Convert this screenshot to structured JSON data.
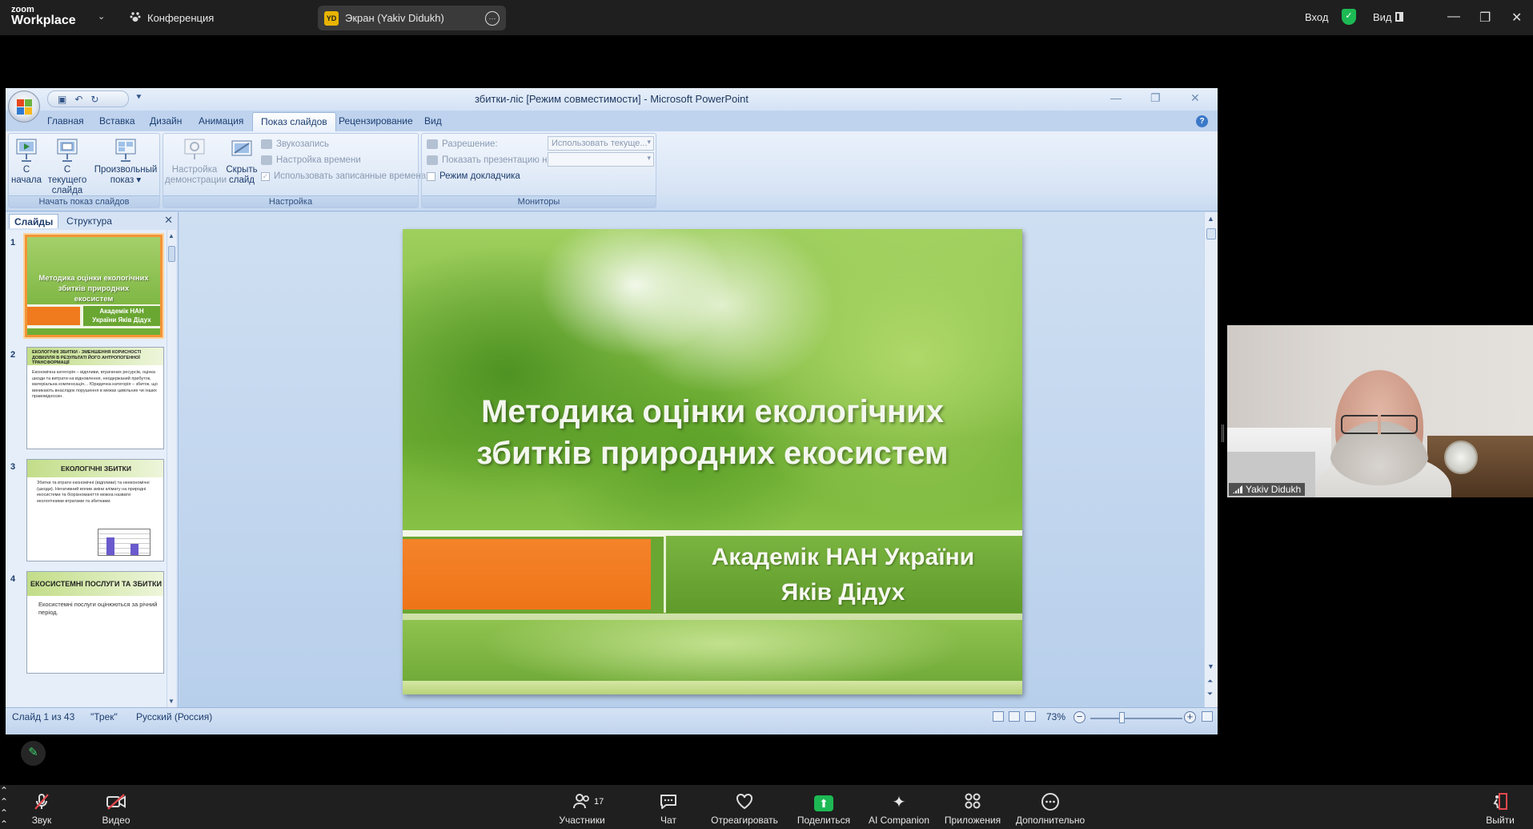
{
  "zoom": {
    "logo_line1": "zoom",
    "logo_line2": "Workplace",
    "conference_label": "Конференция",
    "screen_initials": "YD",
    "screen_label": "Экран (Yakiv Didukh)",
    "signin_label": "Вход",
    "view_label": "Вид",
    "toolbar": {
      "audio_label": "Звук",
      "video_label": "Видео",
      "participants_label": "Участники",
      "participants_count": "17",
      "chat_label": "Чат",
      "react_label": "Отреагировать",
      "share_label": "Поделиться",
      "ai_label": "AI Companion",
      "apps_label": "Приложения",
      "more_label": "Дополнительно",
      "leave_label": "Выйти"
    },
    "participant_name": "Yakiv Didukh"
  },
  "ppt": {
    "title": "збитки-ліс [Режим совместимости] - Microsoft PowerPoint",
    "tabs": [
      "Главная",
      "Вставка",
      "Дизайн",
      "Анимация",
      "Показ слайдов",
      "Рецензирование",
      "Вид"
    ],
    "active_tab": "Показ слайдов",
    "ribbon": {
      "from_start_l1": "С",
      "from_start_l2": "начала",
      "from_current_l1": "С текущего",
      "from_current_l2": "слайда",
      "custom_l1": "Произвольный",
      "custom_l2": "показ ▾",
      "group_start": "Начать показ слайдов",
      "setup_l1": "Настройка",
      "setup_l2": "демонстрации",
      "hide_l1": "Скрыть",
      "hide_l2": "слайд",
      "record_narration": "Звукозапись",
      "rehearse_timings": "Настройка времени",
      "use_timings": "Использовать записанные времена",
      "group_setup": "Настройка",
      "resolution_label": "Разрешение:",
      "resolution_value": "Использовать текуще...",
      "show_on_label": "Показать презентацию на:",
      "show_on_value": "",
      "presenter_view": "Режим докладчика",
      "group_monitors": "Мониторы"
    },
    "panel": {
      "tab_slides": "Слайды",
      "tab_outline": "Структура"
    },
    "thumbnails": [
      {
        "num": "1",
        "title": "Методика оцінки екологічних збитків природних екосистем",
        "sub": "Академік НАН України Яків Дідух"
      },
      {
        "num": "2",
        "title": "ЕКОЛОГІЧНІ ЗБИТКИ - ЗМЕНШЕННЯ КОРИСНОСТІ ДОВКІЛЛЯ В РЕЗУЛЬТАТІ ЙОГО АНТРОПОГЕННОЇ ТРАНСФОРМАЦІЇ",
        "body": "Економічна категорія – відпливи, втрачених ресурсів, оцінка шкоди та витрати на відновлення, неодержаний прибуток, матеріальна компенсація… Юридична категорія – збиток, що виникають внаслідок порушення в межах цивільних чи інших правовідносин."
      },
      {
        "num": "3",
        "title": "ЕКОЛОГІЧНІ ЗБИТКИ",
        "body": "Збитки та втрати економічні (відпливи) та неекономічні (шкоди). Негативний вплив зміни клімату на природні екосистеми та біорізноманіття можна назвати екологічними втратами та збитками."
      },
      {
        "num": "4",
        "title": "ЕКОСИСТЕМНІ ПОСЛУГИ ТА ЗБИТКИ",
        "body": "Екосистемні послуги оцінюються за річний період."
      }
    ],
    "slide": {
      "title_line1": "Методика оцінки екологічних",
      "title_line2": "збитків природних екосистем",
      "sub_line1": "Академік НАН України",
      "sub_line2": "Яків Дідух"
    },
    "status": {
      "slide_of": "Слайд 1 из 43",
      "theme": "\"Трек\"",
      "language": "Русский (Россия)",
      "zoom": "73%"
    }
  },
  "colors": {
    "zoom_bar": "#1f1f1f",
    "share_green": "#1db954",
    "ribbon_blue": "#d7e4f5",
    "slide_orange": "#f07a1e",
    "slide_green": "#6aa632"
  }
}
